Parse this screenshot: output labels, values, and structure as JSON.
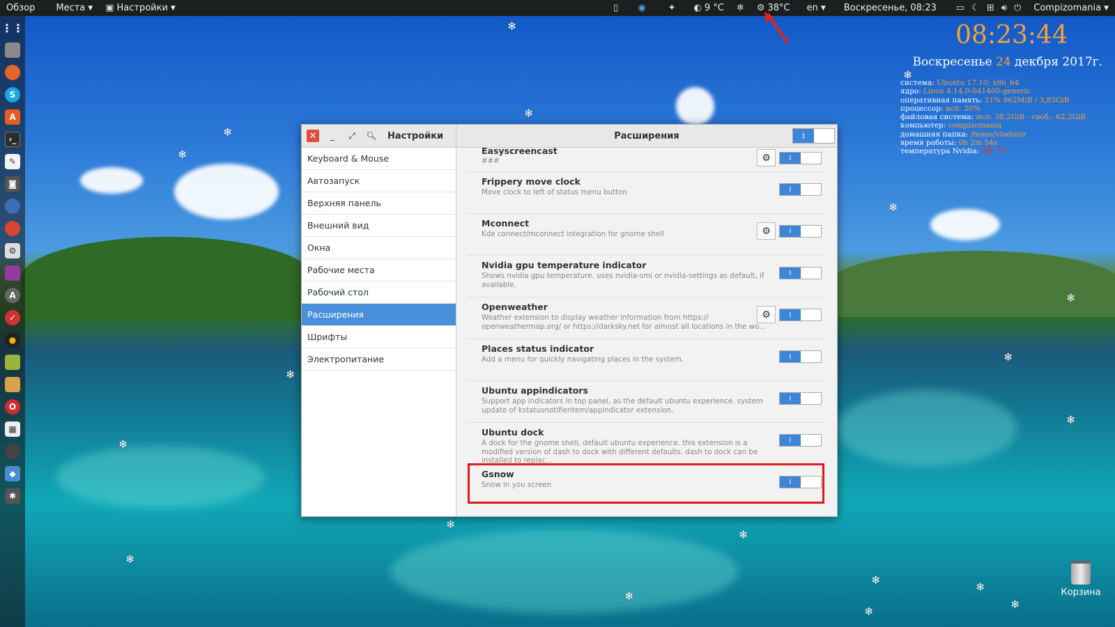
{
  "topbar": {
    "overview": "Обзор",
    "places": "Места",
    "settings_app": "Настройки",
    "temp_weather": "9 °C",
    "temp_gpu": "38°C",
    "lang": "en",
    "datetime": "Воскресенье, 08:23",
    "user": "Compizomania"
  },
  "conky": {
    "time": "08:23:44",
    "date_prefix": "Воскресенье",
    "date_day": "24",
    "date_suffix": "декбря 2017г.",
    "lines": [
      {
        "label": "система: ",
        "value": "Ubuntu 17.10; x86_64"
      },
      {
        "label": "ядро: ",
        "value": "Linux 4.14.0-041400-generic"
      },
      {
        "label": "оперативная память: ",
        "value": "21% 862MiB / 3,85GiB"
      },
      {
        "label": "процессор: ",
        "value": "исп. 20%"
      },
      {
        "label": "файловая система: ",
        "value": "исп: 38,2GiB - своб.: 62,2GiB"
      },
      {
        "label": "компьютер: ",
        "value": "compizomania"
      },
      {
        "label": "домашняя папка: ",
        "value": "/home/vladimir"
      },
      {
        "label": "время работы: ",
        "value": "0h 2m 54s"
      },
      {
        "label": "температура Nvidia: ",
        "value": "38 °C"
      }
    ]
  },
  "window": {
    "left_title": "Настройки",
    "right_title": "Расширения",
    "switch_on_label": "I"
  },
  "sidebar": {
    "items": [
      {
        "label": "Keyboard & Mouse"
      },
      {
        "label": "Автозапуск"
      },
      {
        "label": "Верхняя панель"
      },
      {
        "label": "Внешний вид"
      },
      {
        "label": "Окна"
      },
      {
        "label": "Рабочие места"
      },
      {
        "label": "Рабочий стол"
      },
      {
        "label": "Расширения",
        "active": true
      },
      {
        "label": "Шрифты"
      },
      {
        "label": "Электропитание"
      }
    ]
  },
  "extensions": [
    {
      "name": "Easyscreencast",
      "desc": "###",
      "gear": true,
      "enabled": true
    },
    {
      "name": "Frippery move clock",
      "desc": "Move clock to left of status menu button",
      "gear": false,
      "enabled": true
    },
    {
      "name": "Mconnect",
      "desc": "Kde connect/mconnect integration for gnome shell",
      "gear": true,
      "enabled": true
    },
    {
      "name": "Nvidia gpu temperature indicator",
      "desc": "Shows nvidia gpu temperature. uses nvidia-smi or nvidia-settings as default, if available.",
      "gear": false,
      "enabled": true
    },
    {
      "name": "Openweather",
      "desc": "Weather extension to display weather information from https:// openweathermap.org/ or https://darksky.net for almost all locations in the wo...",
      "gear": true,
      "enabled": true
    },
    {
      "name": "Places status indicator",
      "desc": "Add a menu for quickly navigating places in the system.",
      "gear": false,
      "enabled": true
    },
    {
      "name": "Ubuntu appindicators",
      "desc": "Support app indicators in top panel, as the default ubuntu experience. system update of kstatusnotifieritem/appindicator extension.",
      "gear": false,
      "enabled": true
    },
    {
      "name": "Ubuntu dock",
      "desc": "A dock for the gnome shell, default ubuntu experience. this extension is a modified version of dash to dock with different defaults. dash to dock can be installed to replac...",
      "gear": false,
      "enabled": true
    },
    {
      "name": "Gsnow",
      "desc": "Snow in you screen",
      "gear": false,
      "enabled": true
    }
  ],
  "desktop": {
    "trash_label": "Корзина"
  }
}
